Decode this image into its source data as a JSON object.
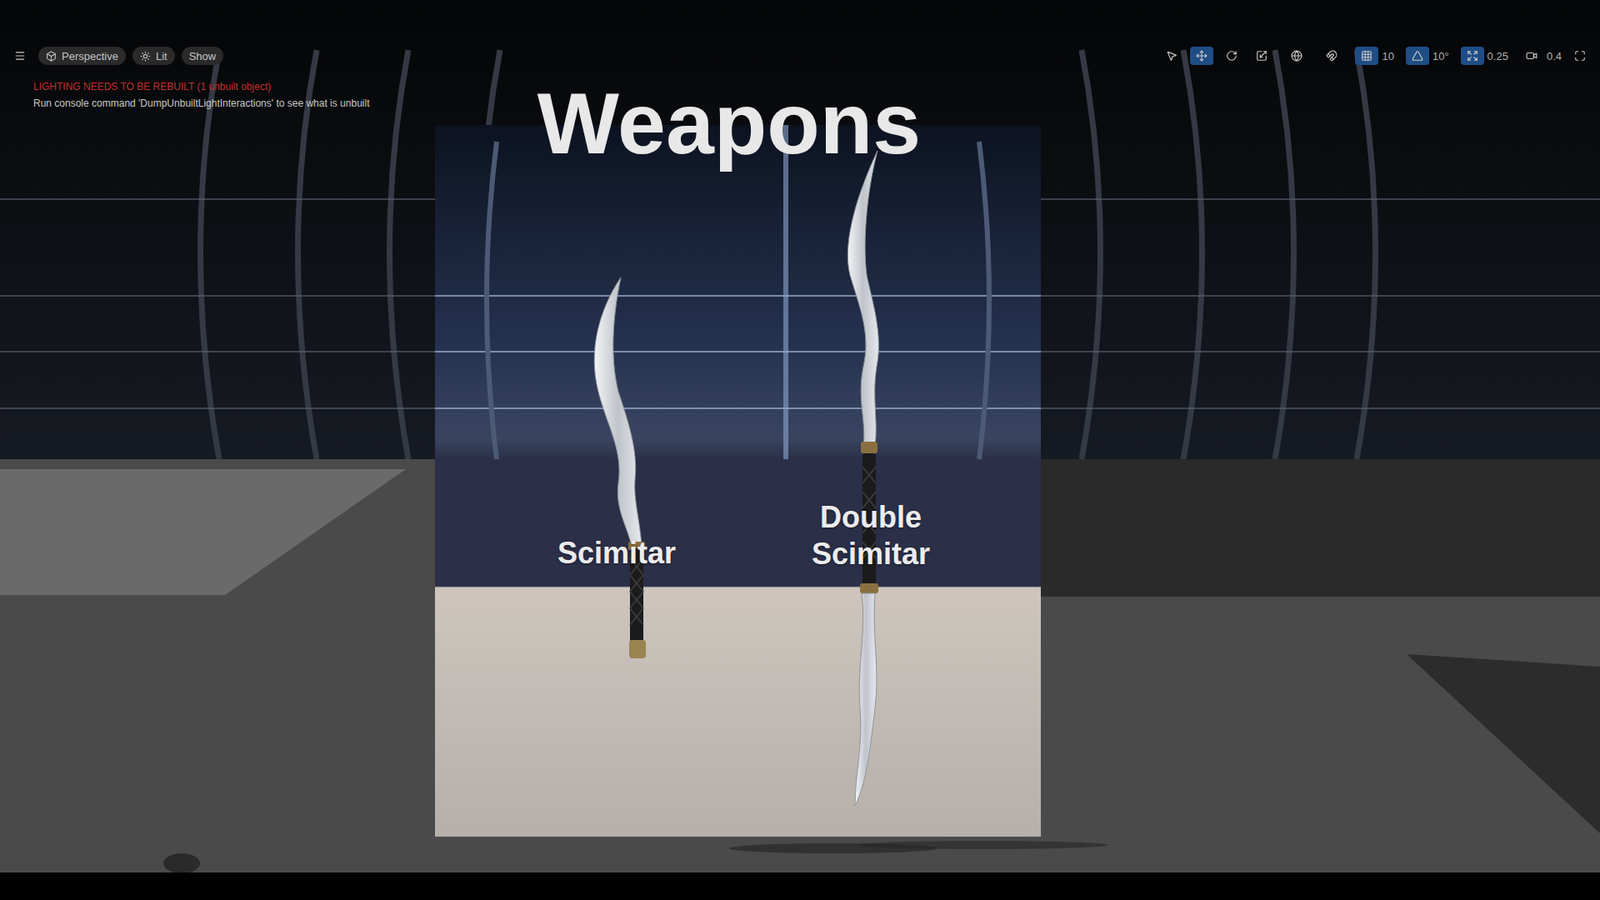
{
  "viewport": {
    "view_mode_buttons": [
      {
        "label": "Perspective",
        "kind": "perspective"
      },
      {
        "label": "Lit",
        "kind": "lit"
      },
      {
        "label": "Show",
        "kind": "show"
      }
    ],
    "warnings": [
      {
        "text": "LIGHTING NEEDS TO BE REBUILT (1 unbuilt object)",
        "color": "#c0302b"
      },
      {
        "text": "Run console command 'DumpUnbuiltLightInteractions' to see what is unbuilt",
        "color": "#c8c8c8"
      }
    ],
    "transform_tools": [
      {
        "tool": "select",
        "selected": false
      },
      {
        "tool": "move",
        "selected": true
      },
      {
        "tool": "rotate",
        "selected": false
      },
      {
        "tool": "scale",
        "selected": false
      }
    ],
    "snap_settings": [
      {
        "kind": "world",
        "value": "",
        "on": false
      },
      {
        "kind": "surface",
        "value": "",
        "on": false
      },
      {
        "kind": "grid",
        "value": "10",
        "on": true
      },
      {
        "kind": "rotation",
        "value": "10°",
        "on": true
      },
      {
        "kind": "scale",
        "value": "0.25",
        "on": true
      },
      {
        "kind": "camera",
        "value": "0.4",
        "on": false
      }
    ]
  },
  "scene": {
    "title": "Weapons",
    "weapons": [
      {
        "kind": "single",
        "label_lines": [
          "Scimitar"
        ]
      },
      {
        "kind": "double",
        "label_lines": [
          "Double",
          "Scimitar"
        ]
      }
    ]
  }
}
